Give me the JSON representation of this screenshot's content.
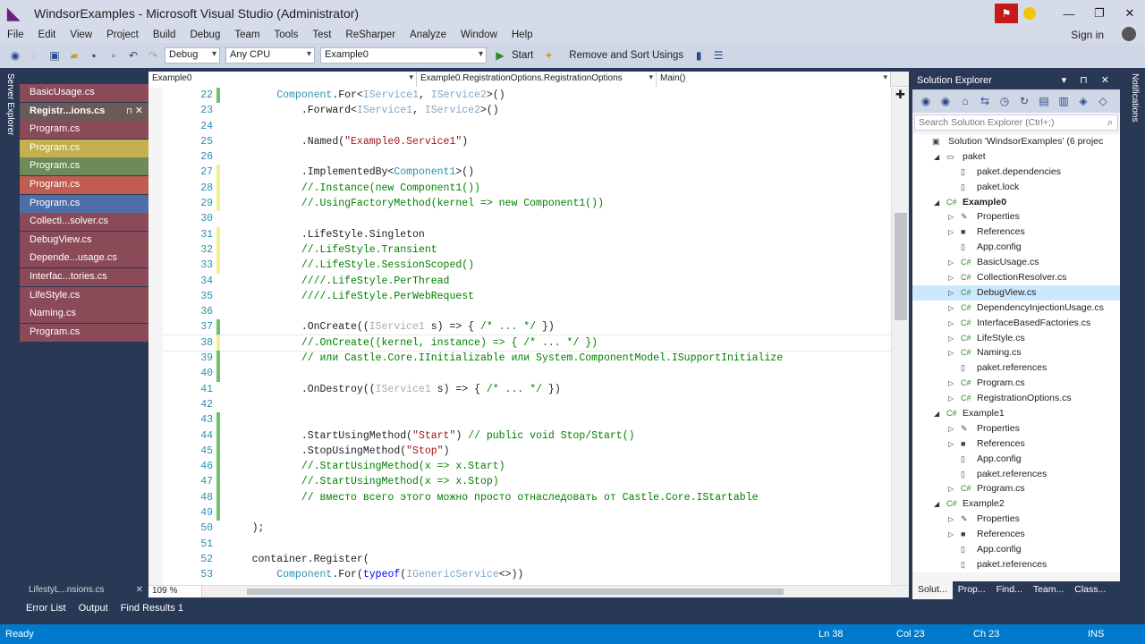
{
  "window": {
    "title": "WindsorExamples - Microsoft Visual Studio (Administrator)",
    "controls": [
      "—",
      "❐",
      "✕"
    ]
  },
  "menu": [
    "File",
    "Edit",
    "View",
    "Project",
    "Build",
    "Debug",
    "Team",
    "Tools",
    "Test",
    "ReSharper",
    "Analyze",
    "Window",
    "Help"
  ],
  "signin": "Sign in",
  "toolbar": {
    "config": "Debug",
    "platform": "Any CPU",
    "startup_project": "Example0",
    "start_label": "Start",
    "remove_sort_usings": "Remove and Sort Usings"
  },
  "left_strip_label": "Server Explorer",
  "right_strip_label": "Notifications",
  "tab_panel": {
    "tabs": [
      {
        "label": "BasicUsage.cs",
        "color": "#8b4a58"
      },
      {
        "label": "Registr...ions.cs",
        "color": "#6b5a58",
        "active": true
      },
      {
        "label": "Program.cs",
        "color": "#8b4a58"
      },
      {
        "label": "Program.cs",
        "color": "#c4b050"
      },
      {
        "label": "Program.cs",
        "color": "#6e8a5a"
      },
      {
        "label": "Program.cs",
        "color": "#c25c50"
      },
      {
        "label": "Program.cs",
        "color": "#4f6ea8"
      },
      {
        "label": "Collecti...solver.cs",
        "color": "#8b4a58"
      },
      {
        "label": "DebugView.cs",
        "color": "#8b4a58"
      },
      {
        "label": "Depende...usage.cs",
        "color": "#8b4a58"
      },
      {
        "label": "Interfac...tories.cs",
        "color": "#8b4a58"
      },
      {
        "label": "LifeStyle.cs",
        "color": "#8b4a58"
      },
      {
        "label": "Naming.cs",
        "color": "#8b4a58"
      },
      {
        "label": "Program.cs",
        "color": "#8b4a58"
      }
    ],
    "bottom_label": "LifestyL...nsions.cs"
  },
  "editor": {
    "nav": [
      "Example0",
      "Example0.RegistrationOptions.RegistrationOptions",
      "Main()"
    ],
    "zoom": "109 %",
    "lines": [
      {
        "n": "22",
        "chg": "#6cc26c",
        "tokens": [
          [
            "        ",
            "plain"
          ],
          [
            "Component",
            "type"
          ],
          [
            ".For<",
            "plain"
          ],
          [
            "IService1",
            "iface"
          ],
          [
            ", ",
            "plain"
          ],
          [
            "IService2",
            "iface"
          ],
          [
            ">()",
            "plain"
          ]
        ]
      },
      {
        "n": "23",
        "chg": "",
        "tokens": [
          [
            "            .Forward<",
            "plain"
          ],
          [
            "IService1",
            "iface"
          ],
          [
            ", ",
            "plain"
          ],
          [
            "IService2",
            "iface"
          ],
          [
            ">()",
            "plain"
          ]
        ]
      },
      {
        "n": "24",
        "chg": "",
        "tokens": []
      },
      {
        "n": "25",
        "chg": "",
        "tokens": [
          [
            "            .Named(",
            "plain"
          ],
          [
            "\"Example0.Service1\"",
            "string"
          ],
          [
            ")",
            "plain"
          ]
        ]
      },
      {
        "n": "26",
        "chg": "",
        "tokens": []
      },
      {
        "n": "27",
        "chg": "#f0f08a",
        "tokens": [
          [
            "            .ImplementedBy<",
            "plain"
          ],
          [
            "Component1",
            "type"
          ],
          [
            ">()",
            "plain"
          ]
        ]
      },
      {
        "n": "28",
        "chg": "#f0f08a",
        "tokens": [
          [
            "            //.Instance(new Component1())",
            "comment"
          ]
        ]
      },
      {
        "n": "29",
        "chg": "#f0f08a",
        "tokens": [
          [
            "            //.UsingFactoryMethod(kernel => new Component1())",
            "comment"
          ]
        ]
      },
      {
        "n": "30",
        "chg": "",
        "tokens": []
      },
      {
        "n": "31",
        "chg": "#f0f08a",
        "tokens": [
          [
            "            .LifeStyle.Singleton",
            "plain"
          ]
        ]
      },
      {
        "n": "32",
        "chg": "#f0f08a",
        "tokens": [
          [
            "            //.LifeStyle.Transient",
            "comment"
          ]
        ]
      },
      {
        "n": "33",
        "chg": "#f0f08a",
        "tokens": [
          [
            "            //.LifeStyle.SessionScoped()",
            "comment"
          ]
        ]
      },
      {
        "n": "34",
        "chg": "",
        "tokens": [
          [
            "            ////.LifeStyle.PerThread",
            "comment"
          ]
        ]
      },
      {
        "n": "35",
        "chg": "",
        "tokens": [
          [
            "            ////.LifeStyle.PerWebRequest",
            "comment"
          ]
        ]
      },
      {
        "n": "36",
        "chg": "",
        "tokens": []
      },
      {
        "n": "37",
        "chg": "#6cc26c",
        "tokens": [
          [
            "            .OnCreate((",
            "plain"
          ],
          [
            "IService1",
            "grey"
          ],
          [
            " s) => { ",
            "plain"
          ],
          [
            "/* ... */",
            "comment"
          ],
          [
            " })",
            "plain"
          ]
        ]
      },
      {
        "n": "38",
        "chg": "#f0f08a",
        "tokens": [
          [
            "            //.OnCreate((kernel, instance) => { /* ... */ })",
            "comment"
          ]
        ]
      },
      {
        "n": "39",
        "chg": "#6cc26c",
        "tokens": [
          [
            "            // или Castle.Core.IInitializable или System.ComponentModel.ISupportInitialize",
            "comment"
          ]
        ]
      },
      {
        "n": "40",
        "chg": "#6cc26c",
        "tokens": []
      },
      {
        "n": "41",
        "chg": "",
        "tokens": [
          [
            "            .OnDestroy((",
            "plain"
          ],
          [
            "IService1",
            "grey"
          ],
          [
            " s) => { ",
            "plain"
          ],
          [
            "/* ... */",
            "comment"
          ],
          [
            " })",
            "plain"
          ]
        ]
      },
      {
        "n": "42",
        "chg": "",
        "tokens": []
      },
      {
        "n": "43",
        "chg": "#6cc26c",
        "tokens": []
      },
      {
        "n": "44",
        "chg": "#6cc26c",
        "tokens": [
          [
            "            .StartUsingMethod(",
            "plain"
          ],
          [
            "\"Start\"",
            "string"
          ],
          [
            ") ",
            "plain"
          ],
          [
            "// public void Stop/Start()",
            "comment"
          ]
        ]
      },
      {
        "n": "45",
        "chg": "#6cc26c",
        "tokens": [
          [
            "            .StopUsingMethod(",
            "plain"
          ],
          [
            "\"Stop\"",
            "string"
          ],
          [
            ")",
            "plain"
          ]
        ]
      },
      {
        "n": "46",
        "chg": "#6cc26c",
        "tokens": [
          [
            "            //.StartUsingMethod(x => x.Start)",
            "comment"
          ]
        ]
      },
      {
        "n": "47",
        "chg": "#6cc26c",
        "tokens": [
          [
            "            //.StartUsingMethod(x => x.Stop)",
            "comment"
          ]
        ]
      },
      {
        "n": "48",
        "chg": "#6cc26c",
        "tokens": [
          [
            "            // вместо всего этого можно просто отнаследовать от Castle.Core.IStartable",
            "comment"
          ]
        ]
      },
      {
        "n": "49",
        "chg": "#6cc26c",
        "tokens": []
      },
      {
        "n": "50",
        "chg": "",
        "tokens": [
          [
            "    );",
            "plain"
          ]
        ]
      },
      {
        "n": "51",
        "chg": "",
        "tokens": []
      },
      {
        "n": "52",
        "chg": "",
        "tokens": [
          [
            "    container.Register(",
            "plain"
          ]
        ]
      },
      {
        "n": "53",
        "chg": "",
        "tokens": [
          [
            "        ",
            "plain"
          ],
          [
            "Component",
            "type"
          ],
          [
            ".For(",
            "plain"
          ],
          [
            "typeof",
            "keyword"
          ],
          [
            "(",
            "plain"
          ],
          [
            "IGenericService",
            "iface"
          ],
          [
            "<>))",
            "plain"
          ]
        ]
      }
    ]
  },
  "solution_explorer": {
    "title": "Solution Explorer",
    "search_placeholder": "Search Solution Explorer (Ctrl+;)",
    "nodes": [
      {
        "label": "Solution 'WindsorExamples' (6 projec",
        "depth": 0,
        "exp": "",
        "icon": "▣",
        "bold": false
      },
      {
        "label": "paket",
        "depth": 1,
        "exp": "◢",
        "icon": "▭",
        "bold": false
      },
      {
        "label": "paket.dependencies",
        "depth": 2,
        "exp": "",
        "icon": "▯",
        "bold": false
      },
      {
        "label": "paket.lock",
        "depth": 2,
        "exp": "",
        "icon": "▯",
        "bold": false
      },
      {
        "label": "Example0",
        "depth": 1,
        "exp": "◢",
        "icon": "C#",
        "bold": true
      },
      {
        "label": "Properties",
        "depth": 2,
        "exp": "▷",
        "icon": "✎",
        "bold": false
      },
      {
        "label": "References",
        "depth": 2,
        "exp": "▷",
        "icon": "■",
        "bold": false
      },
      {
        "label": "App.config",
        "depth": 2,
        "exp": "",
        "icon": "▯",
        "bold": false
      },
      {
        "label": "BasicUsage.cs",
        "depth": 2,
        "exp": "▷",
        "icon": "C#",
        "bold": false
      },
      {
        "label": "CollectionResolver.cs",
        "depth": 2,
        "exp": "▷",
        "icon": "C#",
        "bold": false
      },
      {
        "label": "DebugView.cs",
        "depth": 2,
        "exp": "▷",
        "icon": "C#",
        "bold": false,
        "sel": true
      },
      {
        "label": "DependencyInjectionUsage.cs",
        "depth": 2,
        "exp": "▷",
        "icon": "C#",
        "bold": false
      },
      {
        "label": "InterfaceBasedFactories.cs",
        "depth": 2,
        "exp": "▷",
        "icon": "C#",
        "bold": false
      },
      {
        "label": "LifeStyle.cs",
        "depth": 2,
        "exp": "▷",
        "icon": "C#",
        "bold": false
      },
      {
        "label": "Naming.cs",
        "depth": 2,
        "exp": "▷",
        "icon": "C#",
        "bold": false
      },
      {
        "label": "paket.references",
        "depth": 2,
        "exp": "",
        "icon": "▯",
        "bold": false
      },
      {
        "label": "Program.cs",
        "depth": 2,
        "exp": "▷",
        "icon": "C#",
        "bold": false
      },
      {
        "label": "RegistrationOptions.cs",
        "depth": 2,
        "exp": "▷",
        "icon": "C#",
        "bold": false
      },
      {
        "label": "Example1",
        "depth": 1,
        "exp": "◢",
        "icon": "C#",
        "bold": false
      },
      {
        "label": "Properties",
        "depth": 2,
        "exp": "▷",
        "icon": "✎",
        "bold": false
      },
      {
        "label": "References",
        "depth": 2,
        "exp": "▷",
        "icon": "■",
        "bold": false
      },
      {
        "label": "App.config",
        "depth": 2,
        "exp": "",
        "icon": "▯",
        "bold": false
      },
      {
        "label": "paket.references",
        "depth": 2,
        "exp": "",
        "icon": "▯",
        "bold": false
      },
      {
        "label": "Program.cs",
        "depth": 2,
        "exp": "▷",
        "icon": "C#",
        "bold": false
      },
      {
        "label": "Example2",
        "depth": 1,
        "exp": "◢",
        "icon": "C#",
        "bold": false
      },
      {
        "label": "Properties",
        "depth": 2,
        "exp": "▷",
        "icon": "✎",
        "bold": false
      },
      {
        "label": "References",
        "depth": 2,
        "exp": "▷",
        "icon": "■",
        "bold": false
      },
      {
        "label": "App.config",
        "depth": 2,
        "exp": "",
        "icon": "▯",
        "bold": false
      },
      {
        "label": "paket.references",
        "depth": 2,
        "exp": "",
        "icon": "▯",
        "bold": false
      }
    ],
    "tabs": [
      "Solut...",
      "Prop...",
      "Find...",
      "Team...",
      "Class..."
    ]
  },
  "bottom_tabs": [
    "Error List",
    "Output",
    "Find Results 1"
  ],
  "status": {
    "ready": "Ready",
    "ln": "Ln 38",
    "col": "Col 23",
    "ch": "Ch 23",
    "ins": "INS"
  }
}
